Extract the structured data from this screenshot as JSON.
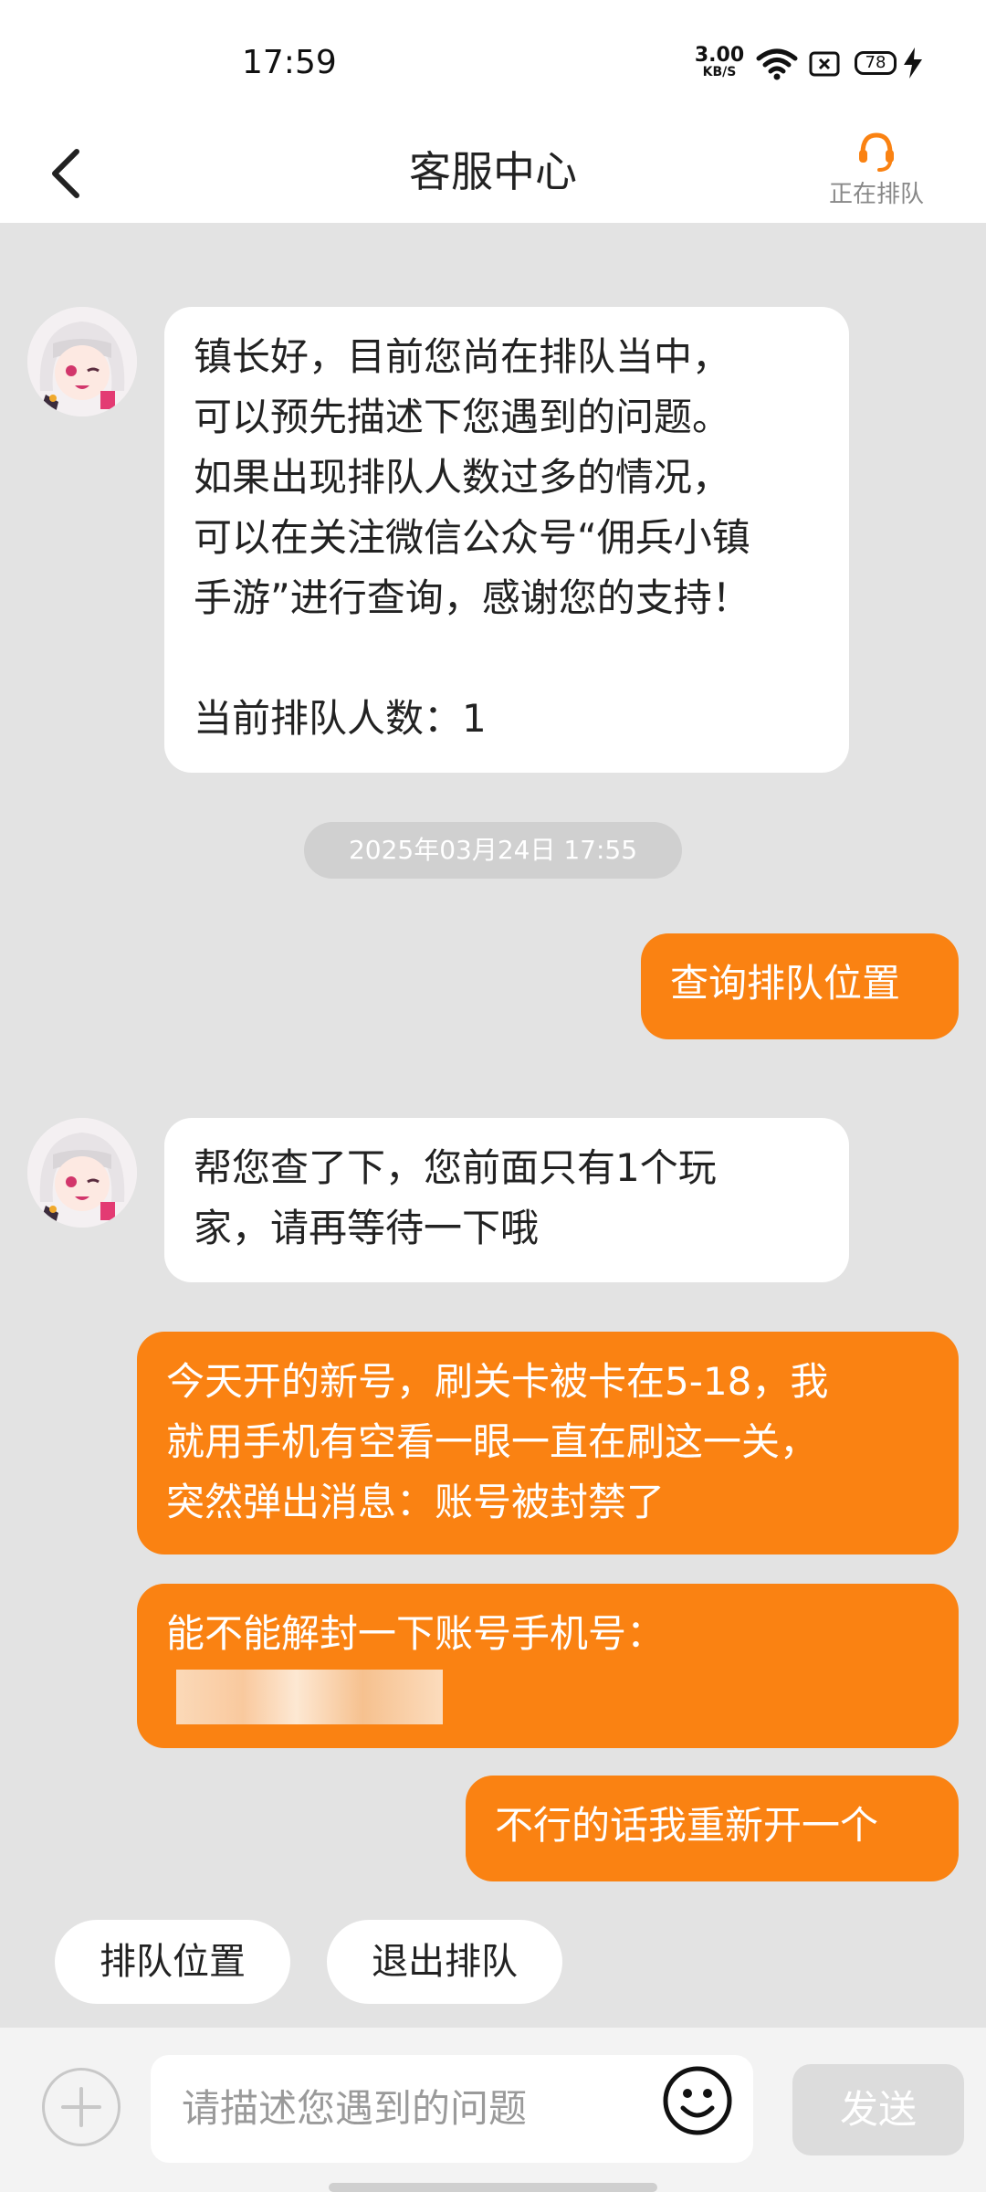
{
  "status_bar": {
    "time": "17:59",
    "net_speed_value": "3.00",
    "net_speed_unit": "KB/S",
    "battery_level": "78",
    "icons": [
      "wifi-icon",
      "sim-icon",
      "battery-icon",
      "charging-icon"
    ]
  },
  "header": {
    "title": "客服中心",
    "queue_status": "正在排队",
    "icons": [
      "back-arrow-icon",
      "headset-icon"
    ],
    "accent_color": "#fa8212"
  },
  "messages": [
    {
      "side": "agent",
      "text": "镇长好，目前您尚在排队当中，\n可以预先描述下您遇到的问题。\n如果出现排队人数过多的情况，\n可以在关注微信公众号“佣兵小镇\n手游”进行查询，感谢您的支持！\n\n当前排队人数：1"
    },
    {
      "side": "timestamp",
      "text": "2025年03月24日 17:55"
    },
    {
      "side": "user",
      "text": "查询排队位置"
    },
    {
      "side": "agent",
      "text": "帮您查了下，您前面只有1个玩\n家，请再等待一下哦"
    },
    {
      "side": "user",
      "text": "今天开的新号，刷关卡被卡在5-18，我\n就用手机有空看一眼一直在刷这一关，\n突然弹出消息：账号被封禁了"
    },
    {
      "side": "user",
      "text": "能不能解封一下账号手机号："
    },
    {
      "side": "user",
      "text": "不行的话我重新开一个"
    }
  ],
  "quick_replies": [
    "排队位置",
    "退出排队"
  ],
  "composer": {
    "placeholder": "请描述您遇到的问题",
    "send_label": "发送",
    "icons": [
      "plus-icon",
      "emoji-icon"
    ]
  },
  "colors": {
    "user_bubble": "#fa8212",
    "agent_bubble": "#ffffff",
    "chat_background": "#e3e3e3"
  }
}
